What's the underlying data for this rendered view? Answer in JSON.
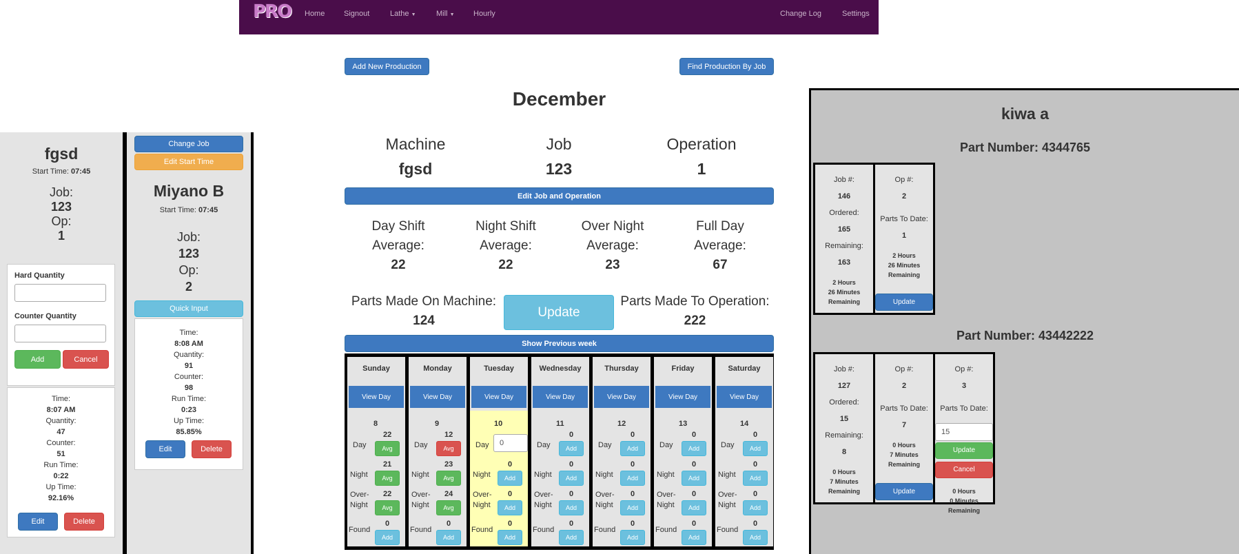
{
  "nav": {
    "home": "Home",
    "signout": "Signout",
    "lathe": "Lathe",
    "mill": "Mill",
    "hourly": "Hourly",
    "changelog": "Change Log",
    "settings": "Settings",
    "logo": "PRO"
  },
  "left": {
    "title": "fgsd",
    "start_label": "Start Time:",
    "start": "07:45",
    "job_label": "Job:",
    "job": "123",
    "op_label": "Op:",
    "op": "1",
    "hard_qty": "Hard Quantity",
    "counter_qty": "Counter Quantity",
    "add": "Add",
    "cancel": "Cancel",
    "time_label": "Time:",
    "time": "8:07 AM",
    "qty_label": "Quantity:",
    "qty": "47",
    "counter_label": "Counter:",
    "counter": "51",
    "run_label": "Run Time:",
    "run": "0:22",
    "up_label": "Up Time:",
    "up": "92.16%",
    "edit": "Edit",
    "delete": "Delete"
  },
  "mid": {
    "change_job": "Change Job",
    "edit_start": "Edit Start Time",
    "title": "Miyano B",
    "start_label": "Start Time:",
    "start": "07:45",
    "job_label": "Job:",
    "job": "123",
    "op_label": "Op:",
    "op": "2",
    "quick": "Quick Input",
    "time_label": "Time:",
    "time": "8:08 AM",
    "qty_label": "Quantity:",
    "qty": "91",
    "counter_label": "Counter:",
    "counter": "98",
    "run_label": "Run Time:",
    "run": "0:23",
    "up_label": "Up Time:",
    "up": "85.85%",
    "edit": "Edit",
    "delete": "Delete"
  },
  "main": {
    "add_new": "Add New Production",
    "find": "Find Production By Job",
    "month": "December",
    "machine_label": "Machine",
    "machine": "fgsd",
    "job_label": "Job",
    "job": "123",
    "op_label": "Operation",
    "op": "1",
    "edit_job": "Edit Job and Operation",
    "averages": [
      {
        "l1": "Day Shift",
        "l2": "Average:",
        "v": "22"
      },
      {
        "l1": "Night Shift",
        "l2": "Average:",
        "v": "22"
      },
      {
        "l1": "Over Night",
        "l2": "Average:",
        "v": "23"
      },
      {
        "l1": "Full Day",
        "l2": "Average:",
        "v": "67"
      }
    ],
    "parts_machine_label": "Parts Made On Machine:",
    "parts_machine": "124",
    "update": "Update",
    "parts_op_label": "Parts Made To Operation:",
    "parts_op": "222",
    "show_prev": "Show Previous week"
  },
  "calendar": {
    "view_day": "View Day",
    "day": "Day",
    "night": "Night",
    "over": "Over-",
    "night2": "Night",
    "found": "Found",
    "avg": "Avg",
    "add": "Add",
    "input_value": "0",
    "days": [
      {
        "name": "Sunday",
        "date": "8",
        "day": "22",
        "night": "21",
        "over": "22",
        "found": "0"
      },
      {
        "name": "Monday",
        "date": "9",
        "day": "12",
        "night": "23",
        "over": "24",
        "found": "0"
      },
      {
        "name": "Tuesday",
        "date": "10",
        "day": "",
        "night": "0",
        "over": "0",
        "found": "0"
      },
      {
        "name": "Wednesday",
        "date": "11",
        "day": "0",
        "night": "0",
        "over": "0",
        "found": "0"
      },
      {
        "name": "Thursday",
        "date": "12",
        "day": "0",
        "night": "0",
        "over": "0",
        "found": "0"
      },
      {
        "name": "Friday",
        "date": "13",
        "day": "0",
        "night": "0",
        "over": "0",
        "found": "0"
      },
      {
        "name": "Saturday",
        "date": "14",
        "day": "0",
        "night": "0",
        "over": "0",
        "found": "0"
      }
    ]
  },
  "right": {
    "title": "kiwa a",
    "part1": "Part Number: 4344765",
    "p1c1": {
      "job_label": "Job #:",
      "job": "146",
      "ordered_label": "Ordered:",
      "ordered": "165",
      "remaining_label": "Remaining:",
      "remaining": "163",
      "h": "2 Hours",
      "m": "26 Minutes",
      "r": "Remaining"
    },
    "p1c2": {
      "op_label": "Op #:",
      "op": "2",
      "ptd_label": "Parts To Date:",
      "ptd": "1",
      "h": "2 Hours",
      "m": "26 Minutes",
      "r": "Remaining",
      "update": "Update"
    },
    "part2": "Part Number: 43442222",
    "p2c1": {
      "job_label": "Job #:",
      "job": "127",
      "ordered_label": "Ordered:",
      "ordered": "15",
      "remaining_label": "Remaining:",
      "remaining": "8",
      "h": "0 Hours",
      "m": "7 Minutes",
      "r": "Remaining"
    },
    "p2c2": {
      "op_label": "Op #:",
      "op": "2",
      "ptd_label": "Parts To Date:",
      "ptd": "7",
      "h": "0 Hours",
      "m": "7 Minutes",
      "r": "Remaining",
      "update": "Update"
    },
    "p2c3": {
      "op_label": "Op #:",
      "op": "3",
      "ptd_label": "Parts To Date:",
      "input": "15",
      "update": "Update",
      "cancel": "Cancel",
      "h": "0 Hours",
      "m": "0 Minutes",
      "r": "Remaining"
    }
  }
}
